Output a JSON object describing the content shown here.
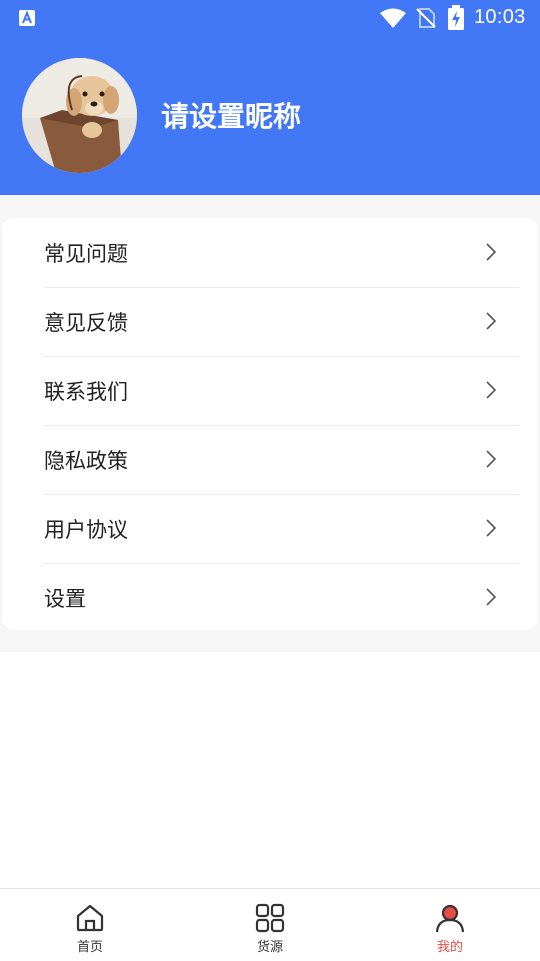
{
  "status_bar": {
    "time": "10:03",
    "icons": [
      "app-notification-icon",
      "wifi-icon",
      "no-sim-icon",
      "battery-charging-icon"
    ]
  },
  "profile": {
    "nickname": "请设置昵称",
    "avatar": "dog-in-bag-photo"
  },
  "menu": {
    "items": [
      {
        "label": "常见问题"
      },
      {
        "label": "意见反馈"
      },
      {
        "label": "联系我们"
      },
      {
        "label": "隐私政策"
      },
      {
        "label": "用户协议"
      },
      {
        "label": "设置"
      }
    ]
  },
  "tabbar": {
    "tabs": [
      {
        "label": "首页",
        "icon": "home-icon"
      },
      {
        "label": "货源",
        "icon": "grid-icon"
      },
      {
        "label": "我的",
        "icon": "user-icon"
      }
    ],
    "active_index": 2
  },
  "colors": {
    "header_bg": "#4277f5",
    "active_tab": "#e64d45",
    "page_bg": "#f6f6f6"
  }
}
